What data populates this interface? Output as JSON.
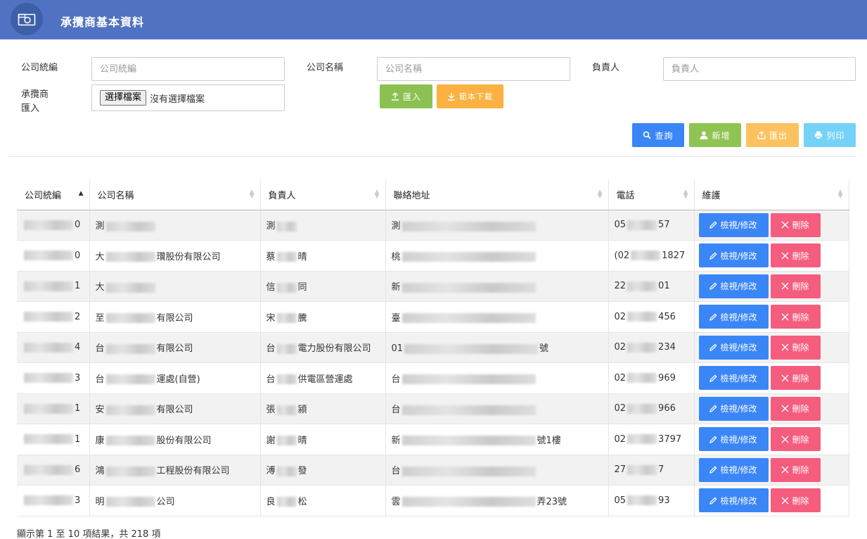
{
  "header": {
    "title": "承攬商基本資料",
    "icon": "camera-icon"
  },
  "form": {
    "tax_id_label": "公司統編",
    "tax_id_placeholder": "公司統編",
    "company_name_label": "公司名稱",
    "company_name_placeholder": "公司名稱",
    "owner_label": "負責人",
    "owner_placeholder": "負責人",
    "import_label_1": "承攬商",
    "import_label_2": "匯入",
    "file_button": "選擇檔案",
    "file_status": "沒有選擇檔案",
    "import_button": "匯入",
    "template_button": "範本下載"
  },
  "toolbar": {
    "query": "查詢",
    "add": "新增",
    "export": "匯出",
    "print": "列印"
  },
  "table": {
    "headers": [
      "公司統編",
      "公司名稱",
      "負責人",
      "聯絡地址",
      "電話",
      "維護"
    ],
    "edit_label": "檢視/修改",
    "delete_label": "刪除",
    "rows": [
      {
        "tax_id": "0",
        "name_a": "測",
        "name_b": "",
        "owner_a": "測",
        "owner_b": "",
        "addr_a": "測",
        "addr_b": "",
        "phone_a": "05",
        "phone_b": "57"
      },
      {
        "tax_id": "0",
        "name_a": "大",
        "name_b": "瓚股份有限公司",
        "owner_a": "蔡",
        "owner_b": "晴",
        "addr_a": "桃",
        "addr_b": "",
        "phone_a": "(02",
        "phone_b": "1827"
      },
      {
        "tax_id": "1",
        "name_a": "大",
        "name_b": "",
        "owner_a": "信",
        "owner_b": "同",
        "addr_a": "新",
        "addr_b": "",
        "phone_a": "22",
        "phone_b": "01"
      },
      {
        "tax_id": "2",
        "name_a": "至",
        "name_b": "有限公司",
        "owner_a": "宋",
        "owner_b": "騰",
        "addr_a": "臺",
        "addr_b": "",
        "phone_a": "02",
        "phone_b": "456"
      },
      {
        "tax_id": "4",
        "name_a": "台",
        "name_b": "有限公司",
        "owner_a": "台",
        "owner_b": "電力股份有限公司",
        "addr_a": "01",
        "addr_b": "號",
        "phone_a": "02",
        "phone_b": "234"
      },
      {
        "tax_id": "3",
        "name_a": "台",
        "name_b": "運處(自營)",
        "owner_a": "台",
        "owner_b": "供電區營運處",
        "addr_a": "台",
        "addr_b": "",
        "phone_a": "02",
        "phone_b": "969"
      },
      {
        "tax_id": "1",
        "name_a": "安",
        "name_b": "有限公司",
        "owner_a": "張",
        "owner_b": "潁",
        "addr_a": "台",
        "addr_b": "",
        "phone_a": "02",
        "phone_b": "966"
      },
      {
        "tax_id": "1",
        "name_a": "康",
        "name_b": "股份有限公司",
        "owner_a": "謝",
        "owner_b": "晴",
        "addr_a": "新",
        "addr_b": "號1樓",
        "phone_a": "02",
        "phone_b": "3797"
      },
      {
        "tax_id": "6",
        "name_a": "鴻",
        "name_b": "工程股份有限公司",
        "owner_a": "溥",
        "owner_b": "發",
        "addr_a": "台",
        "addr_b": "",
        "phone_a": "27",
        "phone_b": "7"
      },
      {
        "tax_id": "3",
        "name_a": "明",
        "name_b": "公司",
        "owner_a": "良",
        "owner_b": "松",
        "addr_a": "雲",
        "addr_b": "弄23號",
        "phone_a": "05",
        "phone_b": "93"
      }
    ]
  },
  "footer": {
    "summary": "顯示第 1 至 10 項結果，共 218 項"
  },
  "colors": {
    "header_bg": "#4f72c2",
    "import_green": "#8cc152",
    "template_orange": "#fcb141",
    "query_blue": "#3b86f7",
    "delete_pink": "#f55d7e"
  }
}
